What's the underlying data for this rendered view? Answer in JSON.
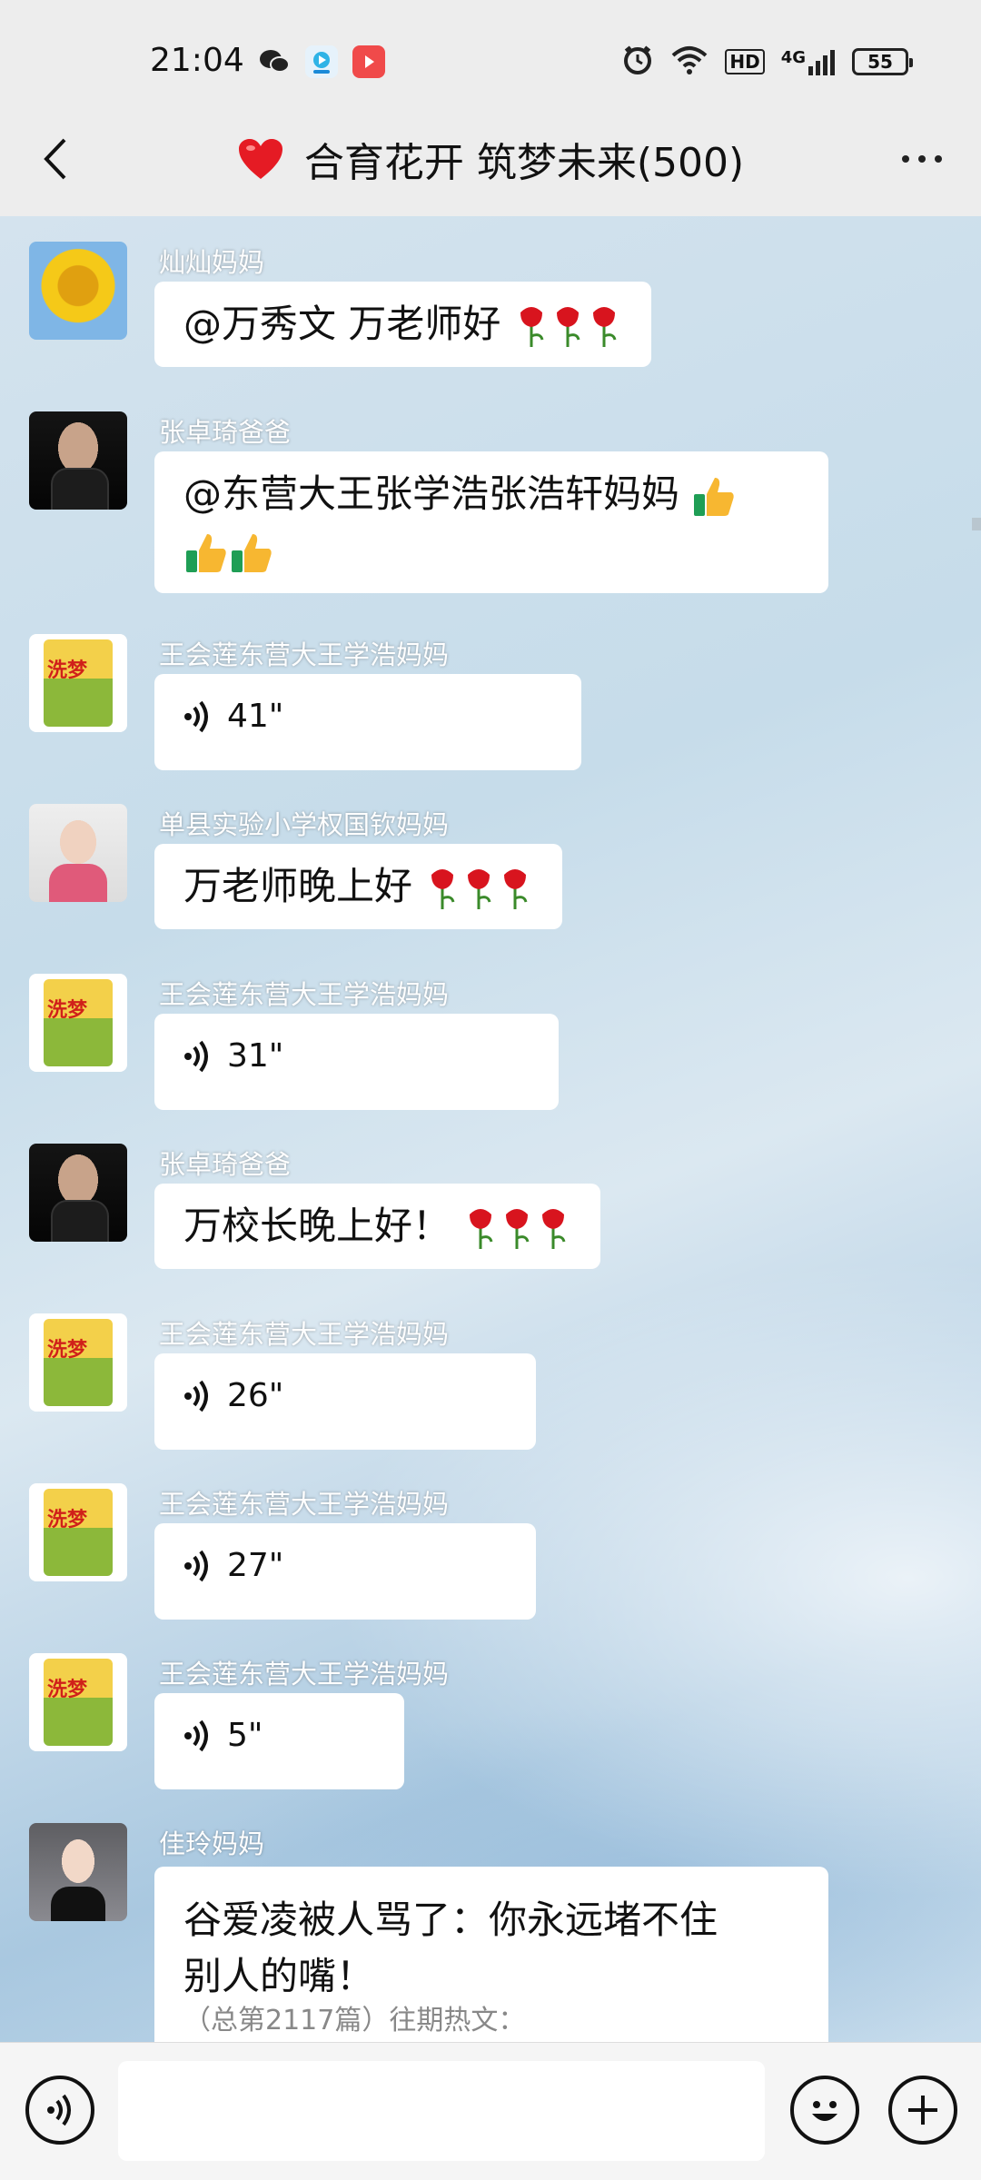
{
  "status_bar": {
    "time": "21:04",
    "left_icons": [
      "wechat-icon",
      "video-app-icon",
      "media-app-icon"
    ],
    "right_icons": [
      "alarm-icon",
      "wifi-icon",
      "hd-icon",
      "signal-4g-icon",
      "battery-icon"
    ],
    "hd_label": "HD",
    "network_label": "4G",
    "battery_level": "55"
  },
  "nav": {
    "title": "合育花开 筑梦未来(500)",
    "title_icon": "red-heart-icon"
  },
  "messages": [
    {
      "sender": "灿灿妈妈",
      "text": "@万秀文  万老师好",
      "emoji": "rose-icon",
      "emoji_count": 3,
      "avatar": "sunflower"
    },
    {
      "sender": "张卓琦爸爸",
      "text": "@东营大王张学浩张浩轩妈妈 ",
      "emoji": "thumbs-up-icon",
      "emoji_count": 3,
      "avatar": "man-in-suit"
    },
    {
      "sender": "王会莲东营大王学浩妈妈",
      "voice_duration": "41\"",
      "avatar": "rice-bag"
    },
    {
      "sender": "单县实验小学权国钦妈妈",
      "text": "万老师晚上好",
      "emoji": "rose-icon",
      "emoji_count": 3,
      "avatar": "woman-with-flowers"
    },
    {
      "sender": "王会莲东营大王学浩妈妈",
      "voice_duration": "31\"",
      "avatar": "rice-bag"
    },
    {
      "sender": "张卓琦爸爸",
      "text": "万校长晚上好！ ",
      "emoji": "rose-icon",
      "emoji_count": 3,
      "avatar": "man-in-suit"
    },
    {
      "sender": "王会莲东营大王学浩妈妈",
      "voice_duration": "26\"",
      "avatar": "rice-bag"
    },
    {
      "sender": "王会莲东营大王学浩妈妈",
      "voice_duration": "27\"",
      "avatar": "rice-bag"
    },
    {
      "sender": "王会莲东营大王学浩妈妈",
      "voice_duration": "5\"",
      "avatar": "rice-bag"
    },
    {
      "sender": "佳玲妈妈",
      "text_line1": "谷爱凌被人骂了：你永远堵不住",
      "text_line2": "别人的嘴！",
      "subtext": "（总第2117篇）往期热文：",
      "avatar": "woman-portrait"
    }
  ],
  "avatar_labels": {
    "rice_bag_brand": "洗梦"
  },
  "input_bar": {
    "placeholder": "",
    "voice_button": "voice-input-icon",
    "emoji_button": "emoji-icon",
    "more_button": "plus-icon"
  }
}
